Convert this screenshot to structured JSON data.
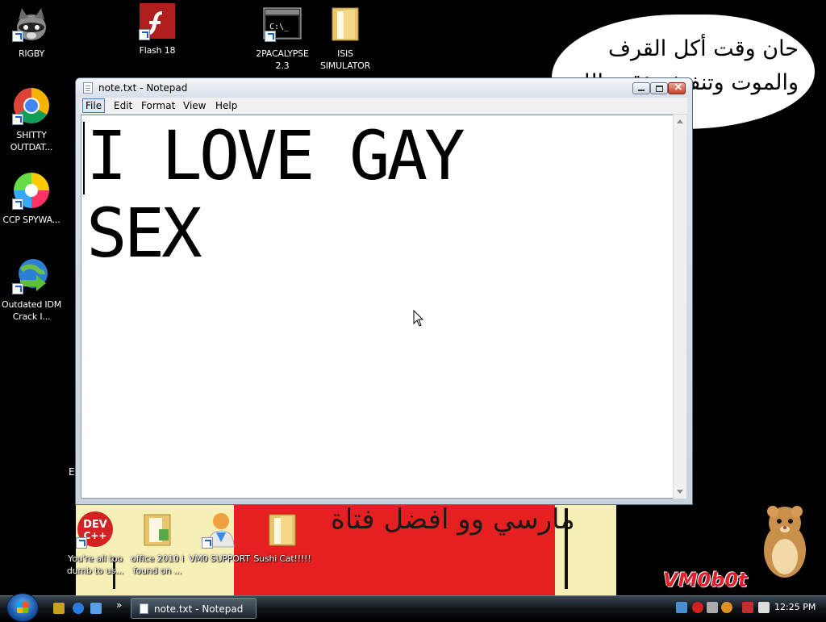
{
  "wallpaper": {
    "bubble_lines": [
      "حان وقت أكل القرف",
      "والموت وتنفيذ مؤقت الله"
    ],
    "red_banner_text": "مارسي وو افضل فتاة",
    "logo_text": "VM0b0t",
    "stray_letter": "E"
  },
  "desktop_icons": [
    {
      "label": "RIGBY"
    },
    {
      "label": "Flash 18"
    },
    {
      "label": "2PACALYPSE 2.3"
    },
    {
      "label": "ISIS SIMULATOR"
    },
    {
      "label": "SHITTY OUTDAT..."
    },
    {
      "label": "CCP SPYWA..."
    },
    {
      "label": "Outdated IDM Crack I..."
    },
    {
      "label": "You're all too dumb to us..."
    },
    {
      "label": "office 2010 i found on ..."
    },
    {
      "label": "VM0 SUPPORT"
    },
    {
      "label": "Sushi Cat!!!!!"
    }
  ],
  "notepad": {
    "title": "note.txt - Notepad",
    "menu": [
      "File",
      "Edit",
      "Format",
      "View",
      "Help"
    ],
    "content": "I LOVE GAY\nSEX"
  },
  "taskbar": {
    "task_label": "note.txt - Notepad",
    "clock": "12:25 PM"
  }
}
